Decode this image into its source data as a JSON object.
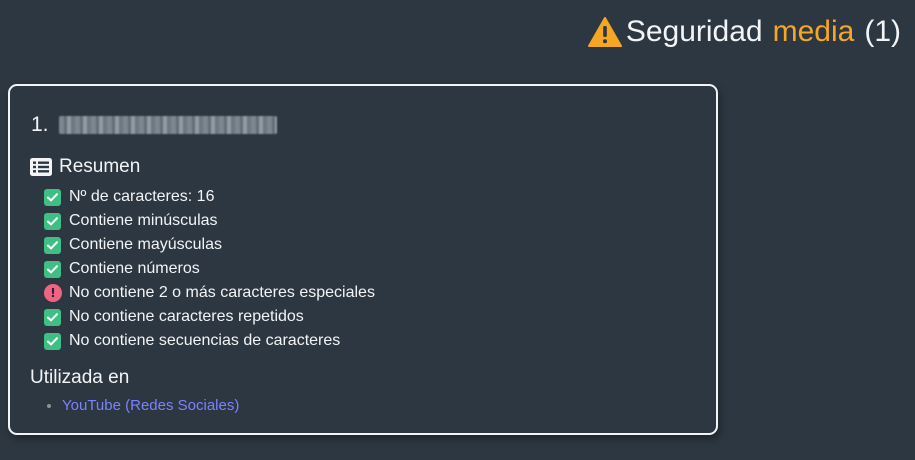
{
  "header": {
    "icon": "warning-icon",
    "prefix": "Seguridad",
    "level": "media",
    "count": "(1)",
    "level_color": "#f5a623"
  },
  "entry": {
    "number": "1.",
    "password_masked": true
  },
  "summary": {
    "icon": "list-icon",
    "title": "Resumen",
    "checks": [
      {
        "label": "Nº de caracteres: 16",
        "status": "ok"
      },
      {
        "label": "Contiene minúsculas",
        "status": "ok"
      },
      {
        "label": "Contiene mayúsculas",
        "status": "ok"
      },
      {
        "label": "Contiene números",
        "status": "ok"
      },
      {
        "label": "No contiene 2 o más caracteres especiales",
        "status": "error"
      },
      {
        "label": "No contiene caracteres repetidos",
        "status": "ok"
      },
      {
        "label": "No contiene secuencias de caracteres",
        "status": "ok"
      }
    ]
  },
  "used_in": {
    "title": "Utilizada en",
    "items": [
      {
        "label": "YouTube (Redes Sociales)"
      }
    ]
  },
  "colors": {
    "background": "#2d3741",
    "ok": "#3fbf83",
    "error": "#f16383",
    "link": "#7b82ff"
  }
}
